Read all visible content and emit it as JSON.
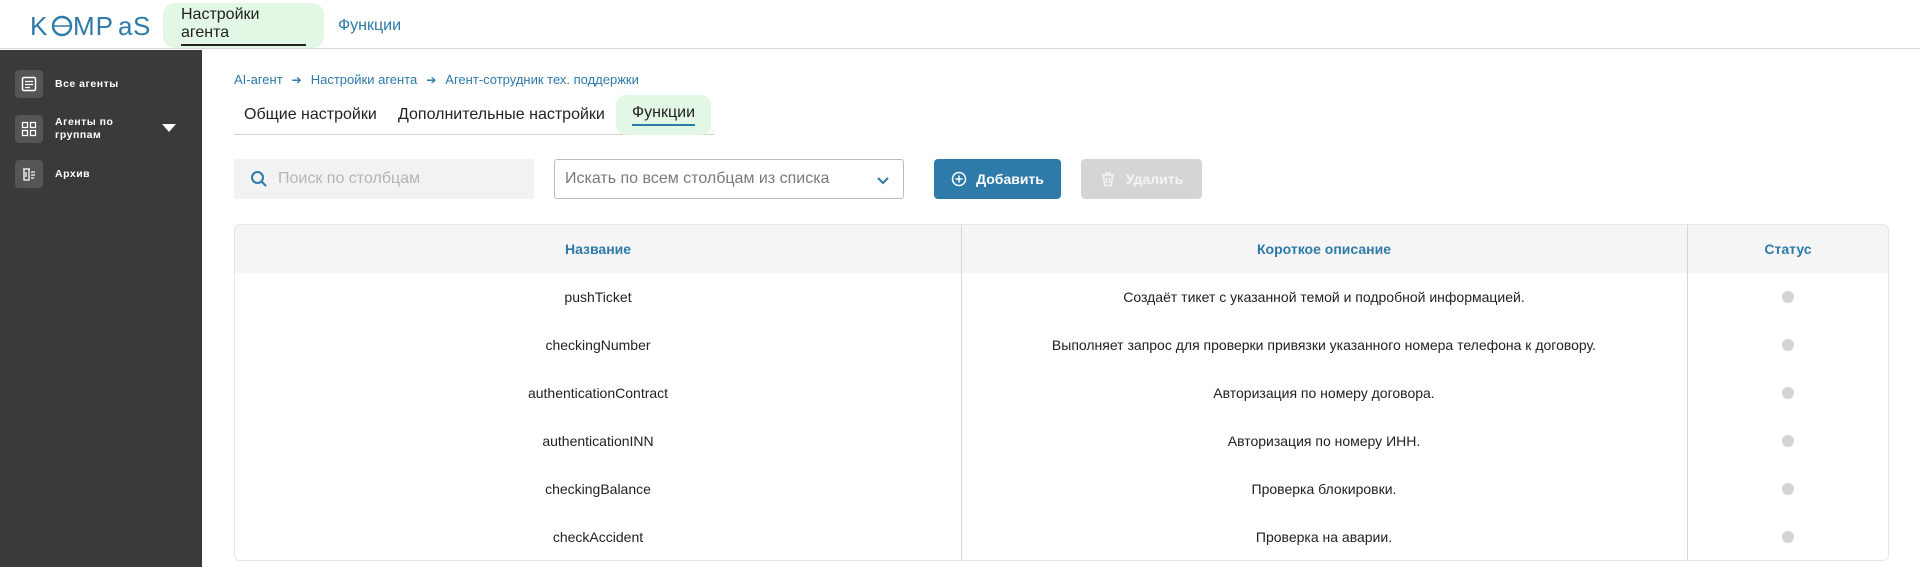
{
  "header": {
    "logo_text": "KOMPaS",
    "tabs": [
      {
        "label": "Настройки агента"
      },
      {
        "label": "Функции"
      }
    ]
  },
  "sidebar": {
    "items": [
      {
        "label": "Все агенты",
        "icon": "document-list-icon"
      },
      {
        "label": "Агенты по группам",
        "icon": "grid-icon"
      },
      {
        "label": "Архив",
        "icon": "archive-icon"
      }
    ]
  },
  "breadcrumb": [
    "AI-агент",
    "Настройки агента",
    "Агент-сотрудник тех. поддержки"
  ],
  "sub_tabs": [
    {
      "label": "Общие настройки"
    },
    {
      "label": "Дополнительные настройки"
    },
    {
      "label": "Функции"
    }
  ],
  "search": {
    "placeholder": "Поиск по столбцам",
    "value": ""
  },
  "column_select": {
    "value": "Искать по всем столбцам из списка"
  },
  "actions": {
    "add_label": "Добавить",
    "delete_label": "Удалить"
  },
  "table": {
    "columns": [
      "Название",
      "Короткое описание",
      "Статус"
    ],
    "rows": [
      {
        "name": "pushTicket",
        "description": "Создаёт тикет с указанной темой и подробной информацией.",
        "status": "inactive"
      },
      {
        "name": "checkingNumber",
        "description": "Выполняет запрос для проверки привязки указанного номера телефона к договору.",
        "status": "inactive"
      },
      {
        "name": "authenticationContract",
        "description": "Авторизация по номеру договора.",
        "status": "inactive"
      },
      {
        "name": "authenticationINN",
        "description": "Авторизация по номеру ИНН.",
        "status": "inactive"
      },
      {
        "name": "checkingBalance",
        "description": "Проверка блокировки.",
        "status": "inactive"
      },
      {
        "name": "checkAccident",
        "description": "Проверка на аварии.",
        "status": "inactive"
      }
    ]
  },
  "colors": {
    "accent": "#2e7aa8",
    "active_tab_bg": "#e2f7e4",
    "sidebar_bg": "#3a3a3a",
    "status_inactive": "#d4d4d4"
  }
}
